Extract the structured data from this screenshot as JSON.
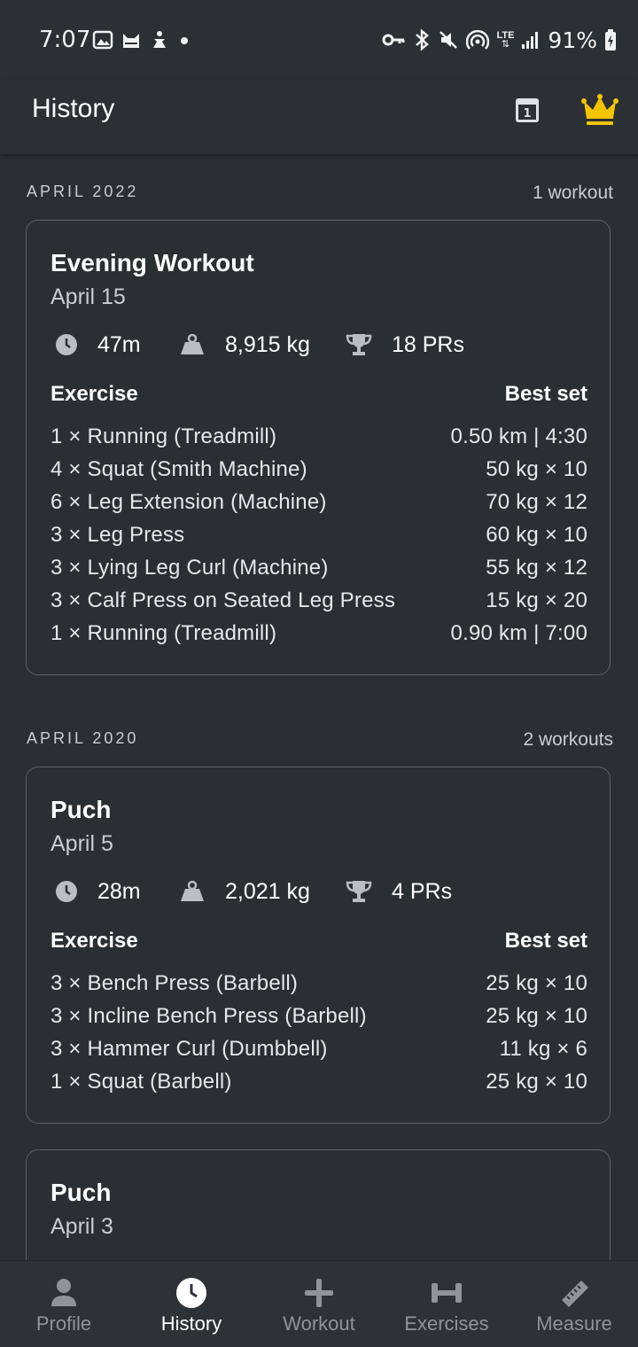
{
  "status_bar": {
    "time": "7:07",
    "battery_percent": "91%",
    "notification_icons": [
      "image-icon",
      "cat-icon",
      "yoga-icon",
      "dot-icon"
    ],
    "system_icons": [
      "key-icon",
      "bluetooth-icon",
      "mute-icon",
      "hotspot-icon",
      "lte-icon",
      "signal-icon",
      "battery-charging-icon"
    ],
    "lte_label": "LTE"
  },
  "app_bar": {
    "title": "History",
    "calendar_day": "1",
    "crown_color": "#f5c400"
  },
  "sections": [
    {
      "month": "APRIL 2022",
      "count": "1 workout",
      "workouts": [
        {
          "title": "Evening Workout",
          "date": "April 15",
          "duration": "47m",
          "volume": "8,915 kg",
          "prs": "18 PRs",
          "exercise_header": "Exercise",
          "best_set_header": "Best set",
          "exercises": [
            {
              "name": "1 × Running (Treadmill)",
              "best": "0.50 km | 4:30"
            },
            {
              "name": "4 × Squat (Smith Machine)",
              "best": "50 kg × 10"
            },
            {
              "name": "6 × Leg Extension (Machine)",
              "best": "70 kg × 12"
            },
            {
              "name": "3 × Leg Press",
              "best": "60 kg × 10"
            },
            {
              "name": "3 × Lying Leg Curl (Machine)",
              "best": "55 kg × 12"
            },
            {
              "name": "3 × Calf Press on Seated Leg Press",
              "best": "15 kg × 20"
            },
            {
              "name": "1 × Running (Treadmill)",
              "best": "0.90 km | 7:00"
            }
          ]
        }
      ]
    },
    {
      "month": "APRIL 2020",
      "count": "2 workouts",
      "workouts": [
        {
          "title": "Puch",
          "date": "April 5",
          "duration": "28m",
          "volume": "2,021 kg",
          "prs": "4 PRs",
          "exercise_header": "Exercise",
          "best_set_header": "Best set",
          "exercises": [
            {
              "name": "3 × Bench Press (Barbell)",
              "best": "25 kg × 10"
            },
            {
              "name": "3 × Incline Bench Press (Barbell)",
              "best": "25 kg × 10"
            },
            {
              "name": "3 × Hammer Curl (Dumbbell)",
              "best": "11 kg × 6"
            },
            {
              "name": "1 × Squat (Barbell)",
              "best": "25 kg × 10"
            }
          ]
        },
        {
          "title": "Puch",
          "date": "April 3"
        }
      ]
    }
  ],
  "bottom_nav": {
    "items": [
      {
        "label": "Profile",
        "icon": "person-icon",
        "active": false
      },
      {
        "label": "History",
        "icon": "clock-icon",
        "active": true
      },
      {
        "label": "Workout",
        "icon": "plus-icon",
        "active": false
      },
      {
        "label": "Exercises",
        "icon": "dumbbell-icon",
        "active": false
      },
      {
        "label": "Measure",
        "icon": "ruler-icon",
        "active": false
      }
    ]
  },
  "colors": {
    "background": "#2a2f34",
    "card_border": "#5b6167",
    "muted_text": "#c9cdd1",
    "stat_icon": "#b9bec3",
    "nav_inactive": "#8e949a",
    "nav_active": "#ffffff",
    "accent_crown": "#f5c400"
  }
}
